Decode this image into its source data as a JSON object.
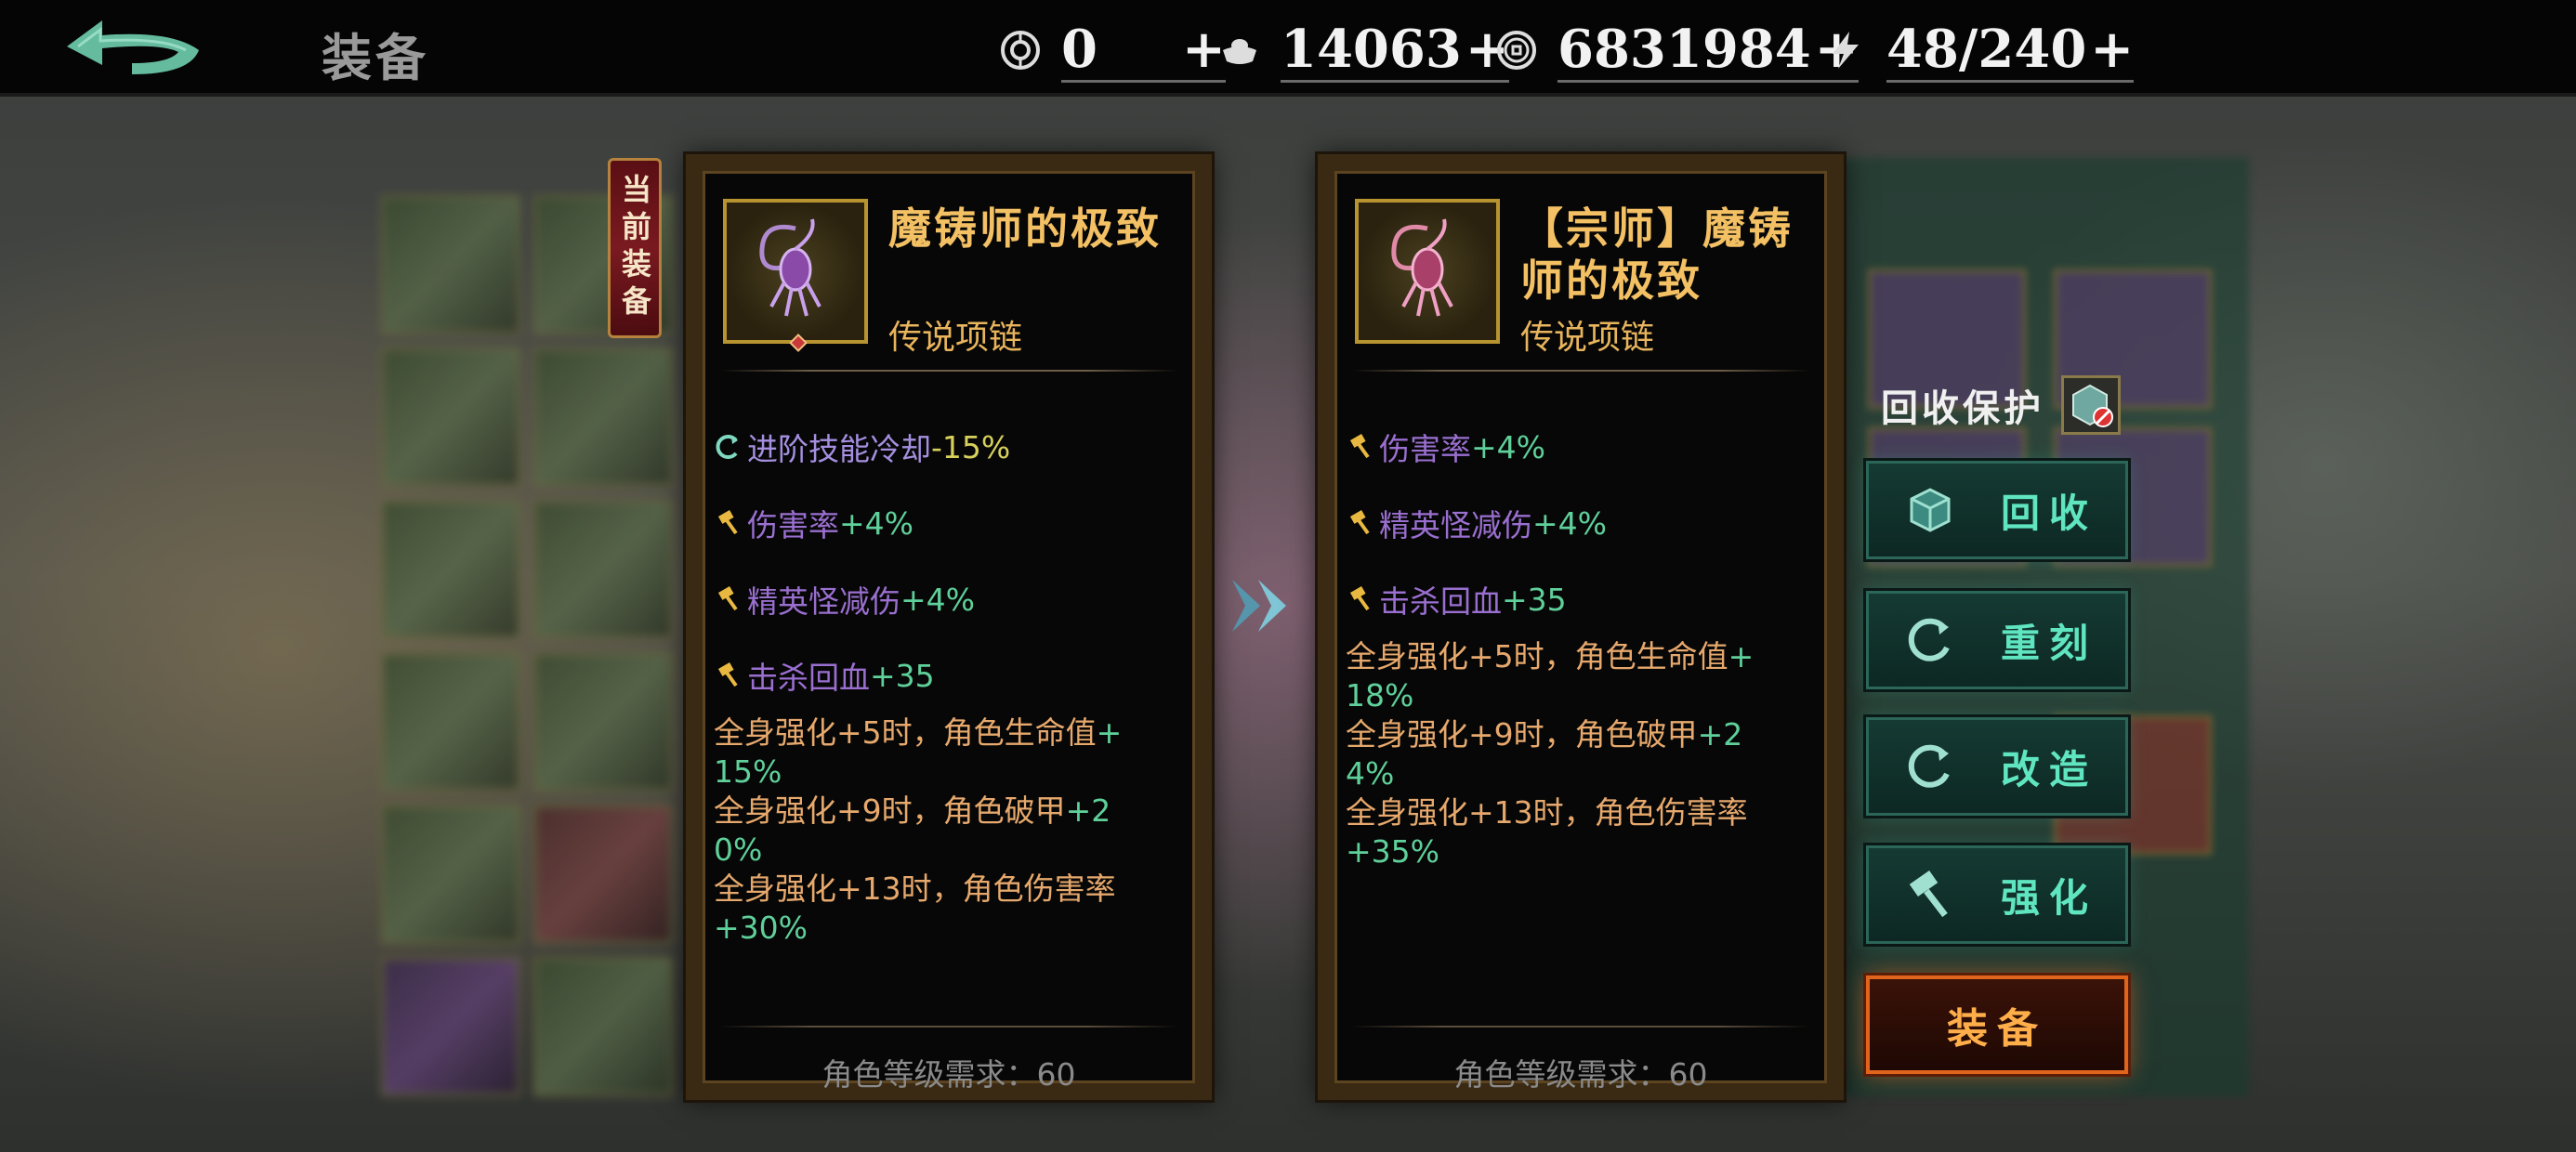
{
  "header": {
    "title": "装备",
    "back_icon": "back-arrow-icon",
    "resources": [
      {
        "icon": "gem-token-icon",
        "value": "0",
        "plus": "+"
      },
      {
        "icon": "ingot-icon",
        "value": "14063",
        "plus": "+"
      },
      {
        "icon": "coin-icon",
        "value": "6831984",
        "plus": "+"
      },
      {
        "icon": "energy-bolt-icon",
        "value": "48/240",
        "plus": "+"
      }
    ]
  },
  "current_tag": "当前装备",
  "current_item": {
    "name": "魔铸师的极致",
    "quality": "传说项链",
    "icon": "scorpion-necklace-icon",
    "attributes": [
      {
        "icon": "cooldown-icon",
        "name": "进阶技能冷却",
        "value": "-15%"
      },
      {
        "icon": "hammer-icon",
        "name": "伤害率",
        "value": "+4%"
      },
      {
        "icon": "hammer-icon",
        "name": "精英怪减伤",
        "value": "+4%"
      },
      {
        "icon": "hammer-icon",
        "name": "击杀回血",
        "value": "+35"
      }
    ],
    "set_bonuses": [
      {
        "text": "全身强化+5时，角色生命值",
        "value": "+\n15%"
      },
      {
        "text": "全身强化+9时，角色破甲",
        "value": "+2\n0%"
      },
      {
        "text": "全身强化+13时，角色伤害率",
        "value": "\n+30%"
      }
    ],
    "requirement": "角色等级需求：60"
  },
  "new_item": {
    "name": "【宗师】魔铸师的极致",
    "quality": "传说项链",
    "icon": "scorpion-necklace-icon",
    "attributes": [
      {
        "icon": "hammer-icon",
        "name": "伤害率",
        "value": "+4%"
      },
      {
        "icon": "hammer-icon",
        "name": "精英怪减伤",
        "value": "+4%"
      },
      {
        "icon": "hammer-icon",
        "name": "击杀回血",
        "value": "+35"
      }
    ],
    "set_bonuses": [
      {
        "text": "全身强化+5时，角色生命值",
        "value": "+\n18%"
      },
      {
        "text": "全身强化+9时，角色破甲",
        "value": "+2\n4%"
      },
      {
        "text": "全身强化+13时，角色伤害率",
        "value": "\n+35%"
      }
    ],
    "requirement": "角色等级需求：60"
  },
  "actions": {
    "protect_label": "回收保护",
    "recycle": "回收",
    "reforge": "重刻",
    "modify": "改造",
    "enhance": "强化",
    "equip": "装备"
  },
  "colors": {
    "name_gold": "#f3c064",
    "attr_purple": "#9a6fd0",
    "value_green": "#5fd09a",
    "set_orange": "#e6a86c",
    "button_teal": "#5fe6c0",
    "equip_orange": "#e1641c"
  }
}
